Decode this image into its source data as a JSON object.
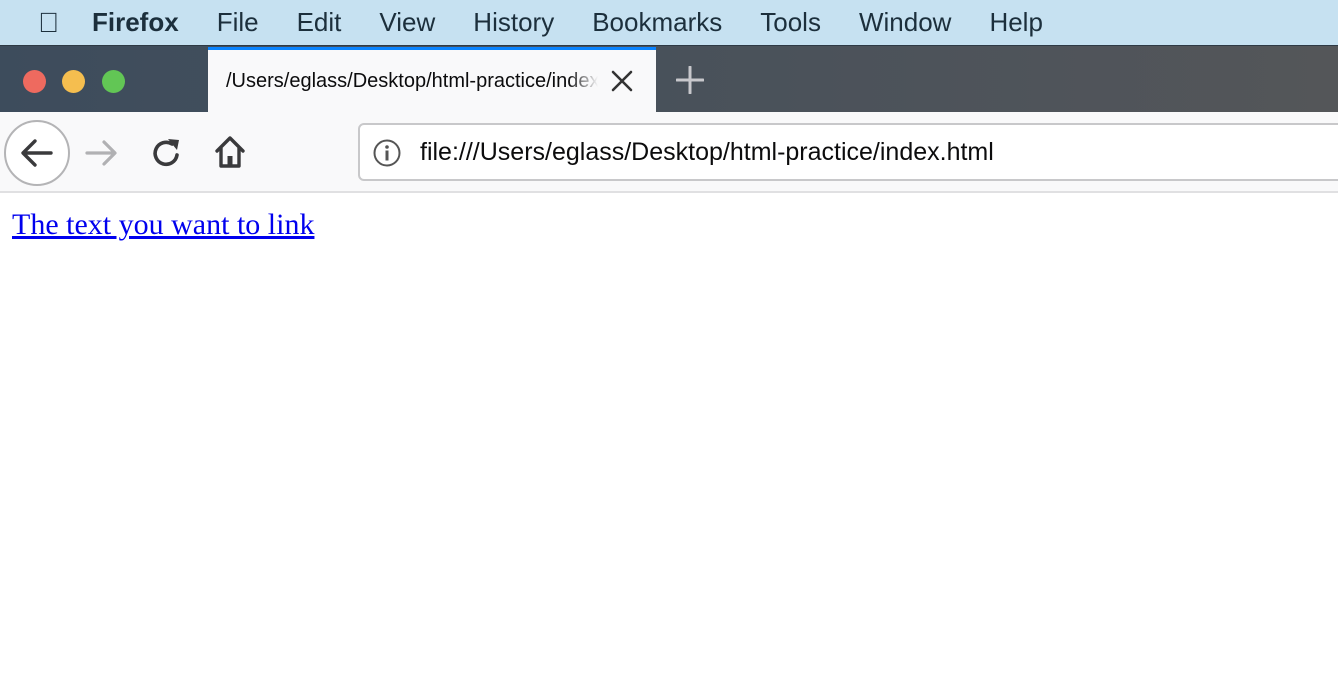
{
  "menubar": {
    "apple_icon": "apple-logo",
    "app": "Firefox",
    "items": [
      "File",
      "Edit",
      "View",
      "History",
      "Bookmarks",
      "Tools",
      "Window",
      "Help"
    ]
  },
  "window": {
    "buttons": {
      "close": "#ee6a5f",
      "minimize": "#f5be4f",
      "zoom": "#62c655"
    }
  },
  "tab": {
    "title": "/Users/eglass/Desktop/html-practice/index.html",
    "accent": "#0a84ff"
  },
  "toolbar": {
    "url": "file:///Users/eglass/Desktop/html-practice/index.html"
  },
  "page": {
    "link_text": "The text you want to link"
  }
}
